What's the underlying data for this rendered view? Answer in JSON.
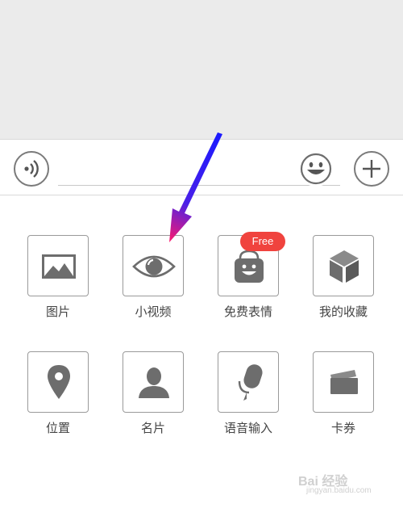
{
  "input_bar": {
    "voice_icon": "voice-waves-icon",
    "emoji_icon": "smiley-face-icon",
    "plus_icon": "plus-icon",
    "text_value": ""
  },
  "tools": [
    {
      "label": "图片",
      "icon": "image-icon"
    },
    {
      "label": "小视频",
      "icon": "eye-icon"
    },
    {
      "label": "免费表情",
      "icon": "sticker-bag-icon",
      "badge": "Free"
    },
    {
      "label": "我的收藏",
      "icon": "cube-icon"
    },
    {
      "label": "位置",
      "icon": "location-pin-icon"
    },
    {
      "label": "名片",
      "icon": "contact-person-icon"
    },
    {
      "label": "语音输入",
      "icon": "microphone-icon"
    },
    {
      "label": "卡券",
      "icon": "card-ticket-icon"
    }
  ],
  "watermark": {
    "title": "Bai 经验",
    "subtitle": "jingyan.baidu.com"
  },
  "colors": {
    "badge": "#f0433e",
    "icon": "#6d6d6d",
    "arrow_start": "#1a1aff",
    "arrow_end": "#ff1a6b"
  }
}
